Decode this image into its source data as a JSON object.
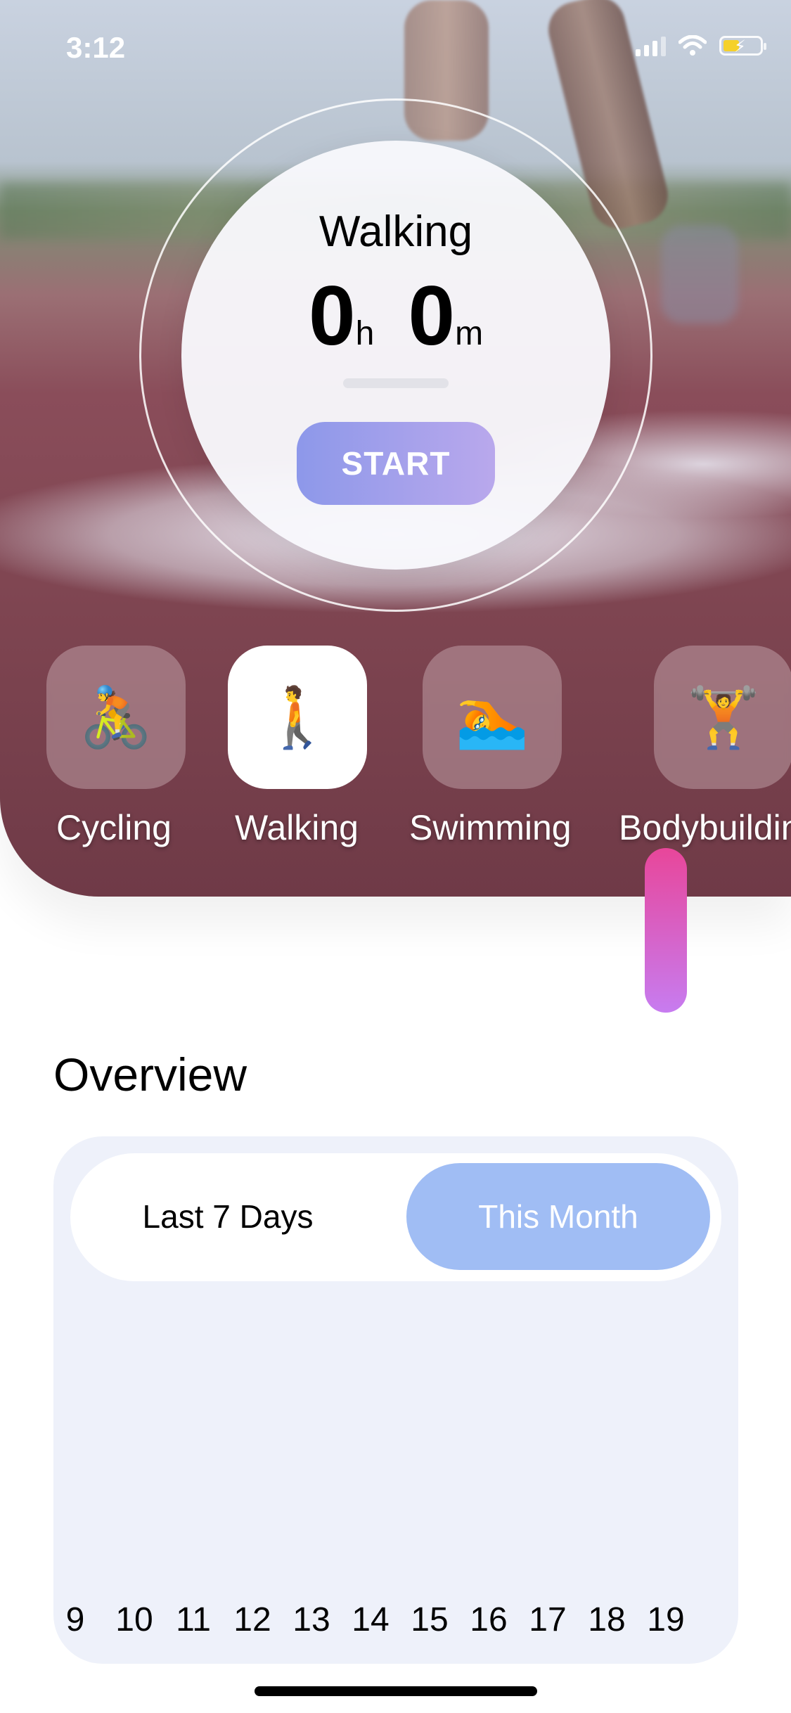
{
  "status_bar": {
    "time": "3:12"
  },
  "timer": {
    "activity": "Walking",
    "hours": "0",
    "hours_unit": "h",
    "minutes": "0",
    "minutes_unit": "m",
    "progress": 0,
    "start_label": "START"
  },
  "activities": [
    {
      "label": "Cycling",
      "icon": "cyclist-icon",
      "emoji": "🚴",
      "active": false
    },
    {
      "label": "Walking",
      "icon": "walker-icon",
      "emoji": "🚶",
      "active": true
    },
    {
      "label": "Swimming",
      "icon": "swimmer-icon",
      "emoji": "🏊",
      "active": false
    },
    {
      "label": "Bodybuildin",
      "icon": "weightlifter-icon",
      "emoji": "🏋",
      "active": false
    }
  ],
  "overview": {
    "title": "Overview",
    "segment": {
      "option_1": "Last 7 Days",
      "option_2": "This Month",
      "selected": "This Month"
    }
  },
  "chart_data": {
    "type": "bar",
    "categories": [
      "9",
      "10",
      "11",
      "12",
      "13",
      "14",
      "15",
      "16",
      "17",
      "18",
      "19"
    ],
    "values": [
      0,
      0,
      0,
      0,
      0,
      0,
      0,
      0,
      0,
      0,
      1
    ],
    "ylim": [
      0,
      1
    ],
    "colors": {
      "bar_top": "#e8469a",
      "bar_bottom": "#c77cf0"
    }
  }
}
